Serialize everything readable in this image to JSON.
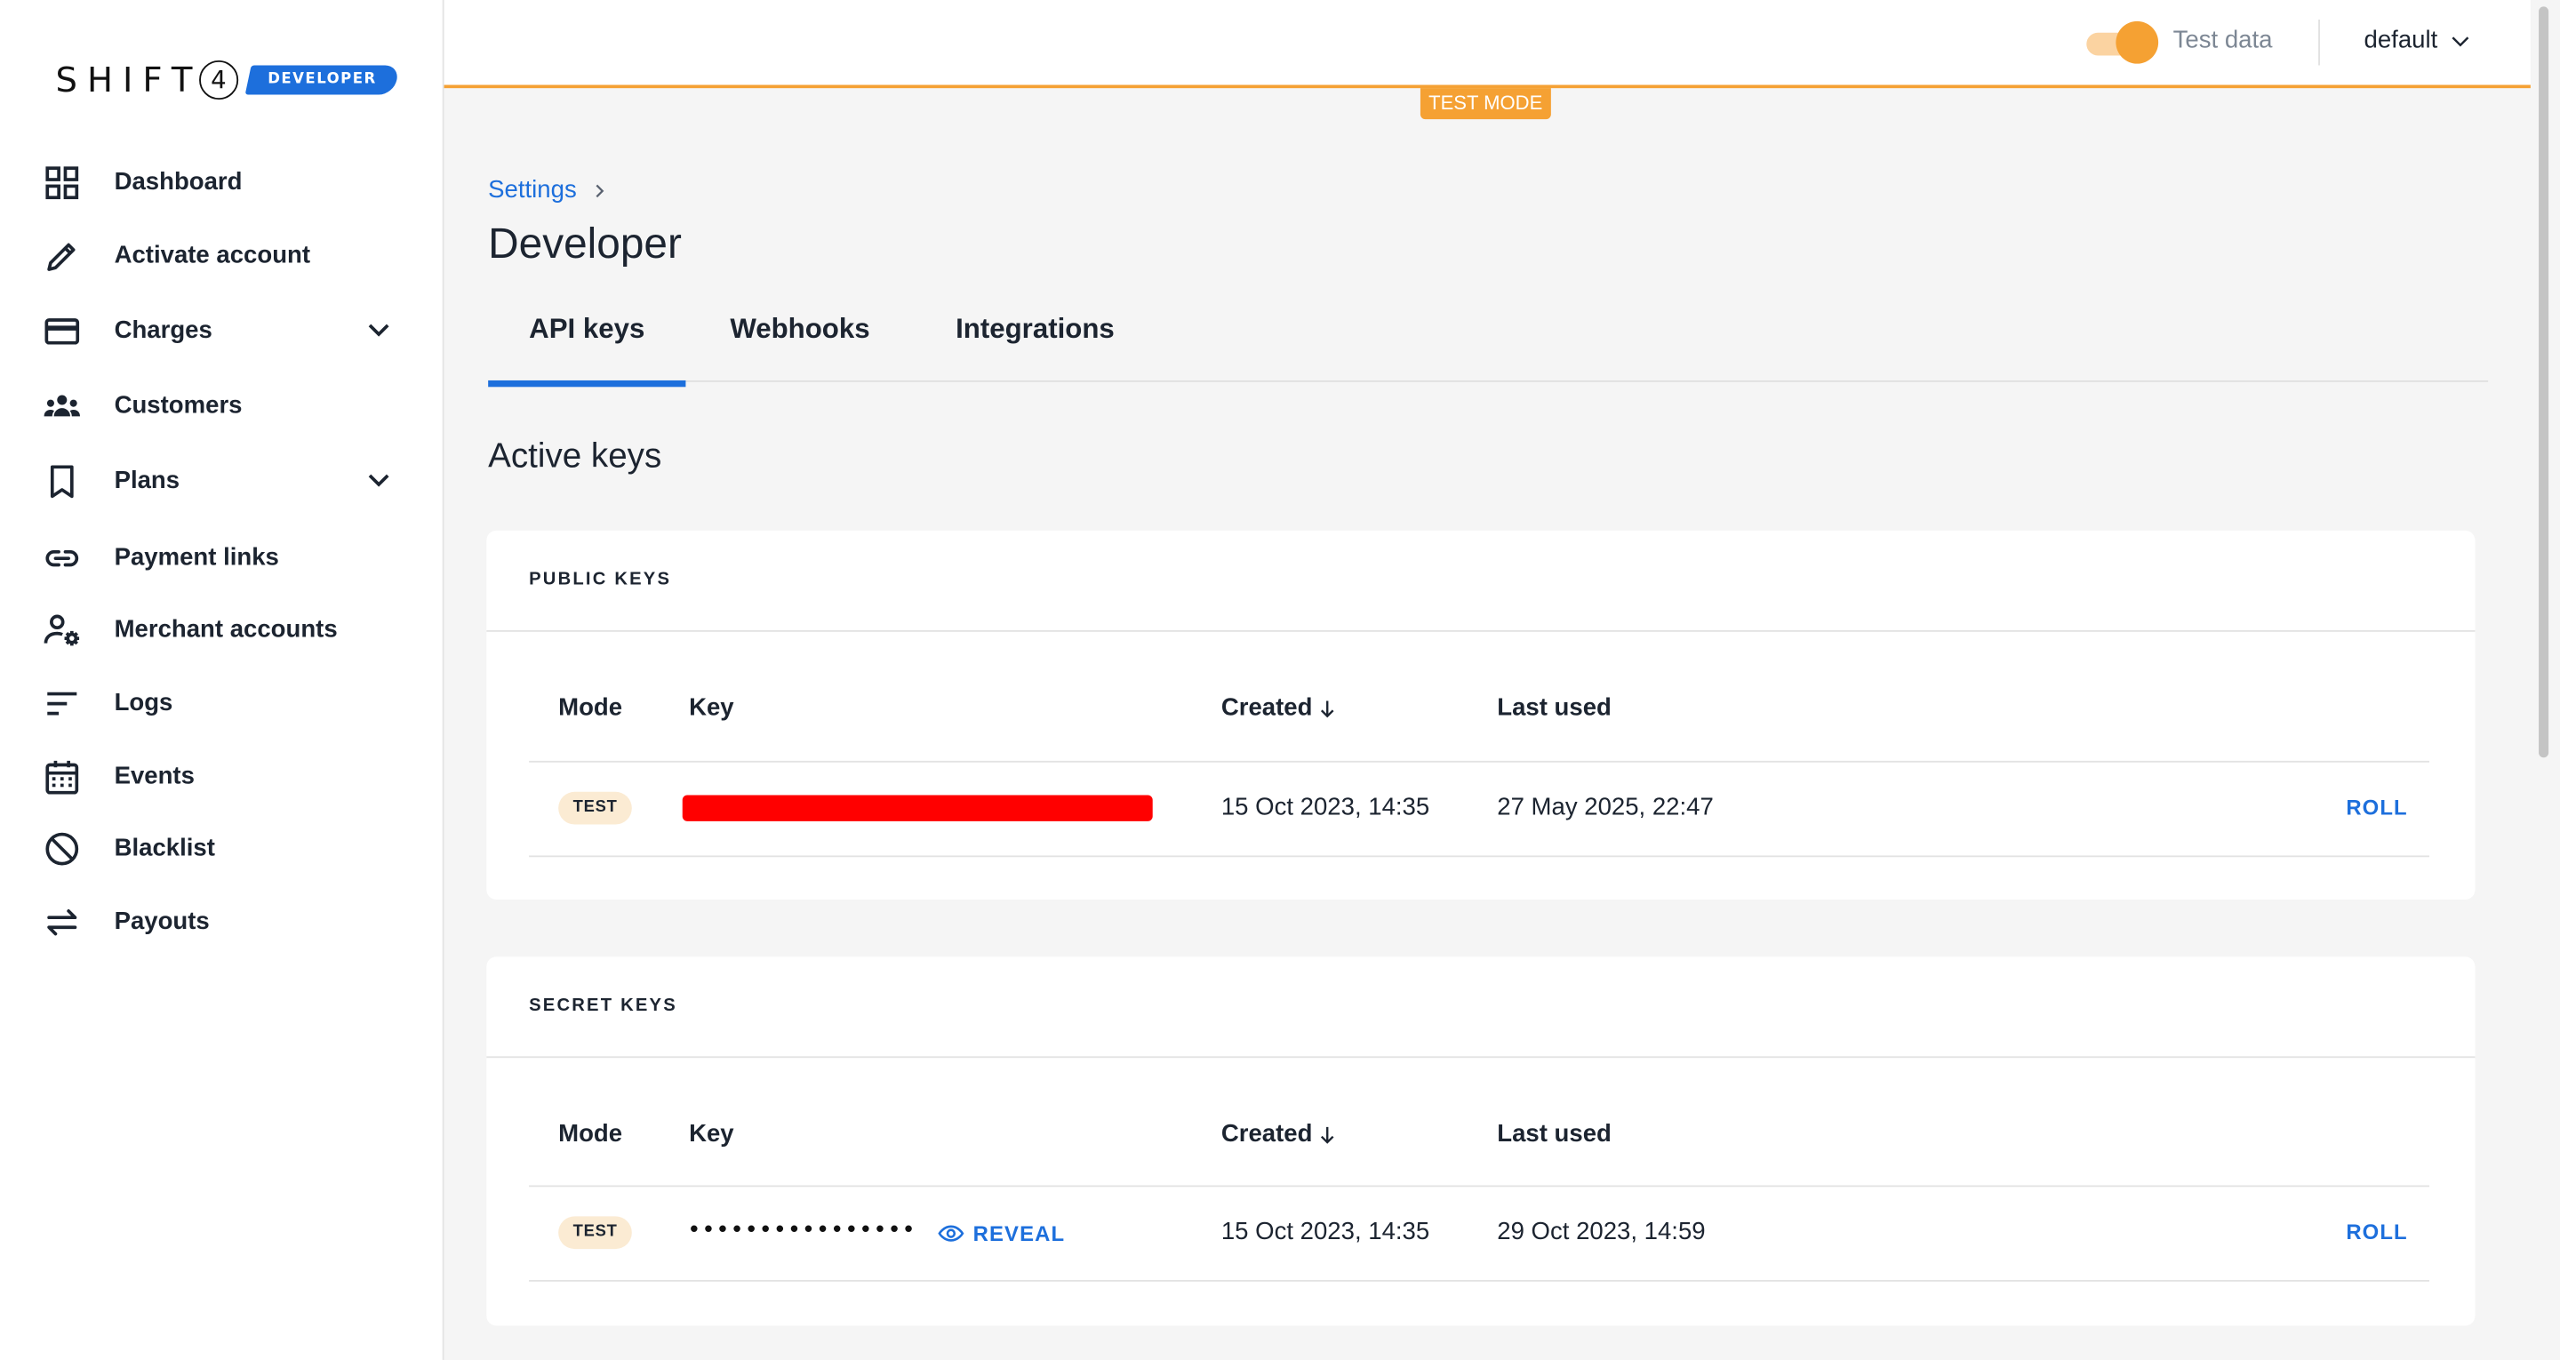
{
  "brand": {
    "name": "SHIFT",
    "number": "4",
    "badge": "DEVELOPER"
  },
  "sidebar": {
    "items": [
      {
        "label": "Dashboard",
        "icon": "dashboard-icon"
      },
      {
        "label": "Activate account",
        "icon": "pencil-icon"
      },
      {
        "label": "Charges",
        "icon": "credit-card-icon",
        "expandable": true
      },
      {
        "label": "Customers",
        "icon": "group-icon"
      },
      {
        "label": "Plans",
        "icon": "bookmark-icon",
        "expandable": true
      },
      {
        "label": "Payment links",
        "icon": "link-icon"
      },
      {
        "label": "Merchant accounts",
        "icon": "user-gear-icon"
      },
      {
        "label": "Logs",
        "icon": "lines-icon"
      },
      {
        "label": "Events",
        "icon": "calendar-icon"
      },
      {
        "label": "Blacklist",
        "icon": "block-icon"
      },
      {
        "label": "Payouts",
        "icon": "swap-arrows-icon"
      }
    ]
  },
  "topbar": {
    "test_data_label": "Test data",
    "test_data_on": true,
    "account": "default",
    "test_mode_banner": "TEST MODE",
    "accent": "#f5a133"
  },
  "breadcrumb": {
    "parent": "Settings"
  },
  "page": {
    "title": "Developer"
  },
  "tabs": [
    {
      "label": "API keys",
      "active": true
    },
    {
      "label": "Webhooks",
      "active": false
    },
    {
      "label": "Integrations",
      "active": false
    }
  ],
  "section_title": "Active keys",
  "tables": {
    "columns": {
      "mode": "Mode",
      "key": "Key",
      "created": "Created",
      "last_used": "Last used"
    },
    "public": {
      "title": "PUBLIC KEYS",
      "rows": [
        {
          "mode": "TEST",
          "key": "[redacted]",
          "created": "15 Oct 2023, 14:35",
          "last_used": "27 May 2025, 22:47",
          "action": "ROLL"
        }
      ]
    },
    "secret": {
      "title": "SECRET KEYS",
      "rows": [
        {
          "mode": "TEST",
          "key": "••••••••••••••••",
          "reveal": "REVEAL",
          "created": "15 Oct 2023, 14:35",
          "last_used": "29 Oct 2023, 14:59",
          "action": "ROLL"
        }
      ]
    }
  },
  "colors": {
    "link": "#1d6fdc",
    "redaction": "#ff0000",
    "badge_bg": "#fbebd3"
  }
}
